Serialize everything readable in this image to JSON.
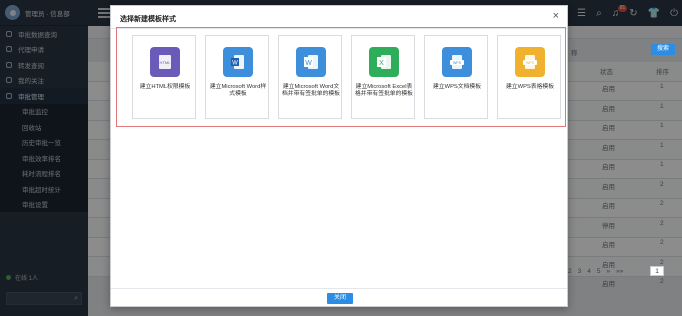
{
  "user": {
    "name": "管理员 · 信息部"
  },
  "sidebar": {
    "items": [
      {
        "label": "审批数据查询"
      },
      {
        "label": "代理申请"
      },
      {
        "label": "转发查阅"
      },
      {
        "label": "我的关注"
      },
      {
        "label": "审批管理",
        "section": true
      },
      {
        "label": "审批监控",
        "sub": true
      },
      {
        "label": "回收站",
        "sub": true
      },
      {
        "label": "历史审批一览",
        "sub": true
      },
      {
        "label": "审批效率排名",
        "sub": true
      },
      {
        "label": "耗时流程排名",
        "sub": true
      },
      {
        "label": "审批超时统计",
        "sub": true
      },
      {
        "label": "审批设置",
        "sub": true
      }
    ],
    "online_label": "在线 1人"
  },
  "topbar": {
    "badge_count": "81"
  },
  "background": {
    "search_button": "搜索",
    "name_label": "称",
    "col_status": "状态",
    "col_order": "排序",
    "status_values": [
      "启用",
      "启用",
      "启用",
      "启用",
      "启用",
      "启用",
      "启用",
      "停用",
      "启用",
      "启用",
      "启用"
    ],
    "order_values": [
      "1",
      "1",
      "1",
      "1",
      "1",
      "2",
      "2",
      "2",
      "2",
      "2",
      "2"
    ],
    "pagination": [
      "2",
      "3",
      "4",
      "5",
      "»",
      "»»"
    ],
    "page_input": "1"
  },
  "modal": {
    "title": "选择新建模板样式",
    "close_button": "关闭",
    "templates": [
      {
        "label": "建立HTML权限模板",
        "color": "#6b5bb8",
        "icon": "html-icon"
      },
      {
        "label": "建立Microsoft Word样式模板",
        "color": "#3d8fdc",
        "icon": "word-icon"
      },
      {
        "label": "建立Microsoft Word文档并带有签批单的模板",
        "color": "#3d8fdc",
        "icon": "word-icon"
      },
      {
        "label": "建立Microsoft Excel表格并带有签批单的模板",
        "color": "#2eae5b",
        "icon": "excel-icon"
      },
      {
        "label": "建立WPS文档模板",
        "color": "#3d8fdc",
        "icon": "wps-doc-icon"
      },
      {
        "label": "建立WPS表格模板",
        "color": "#f0b22e",
        "icon": "wps-sheet-icon"
      }
    ]
  }
}
